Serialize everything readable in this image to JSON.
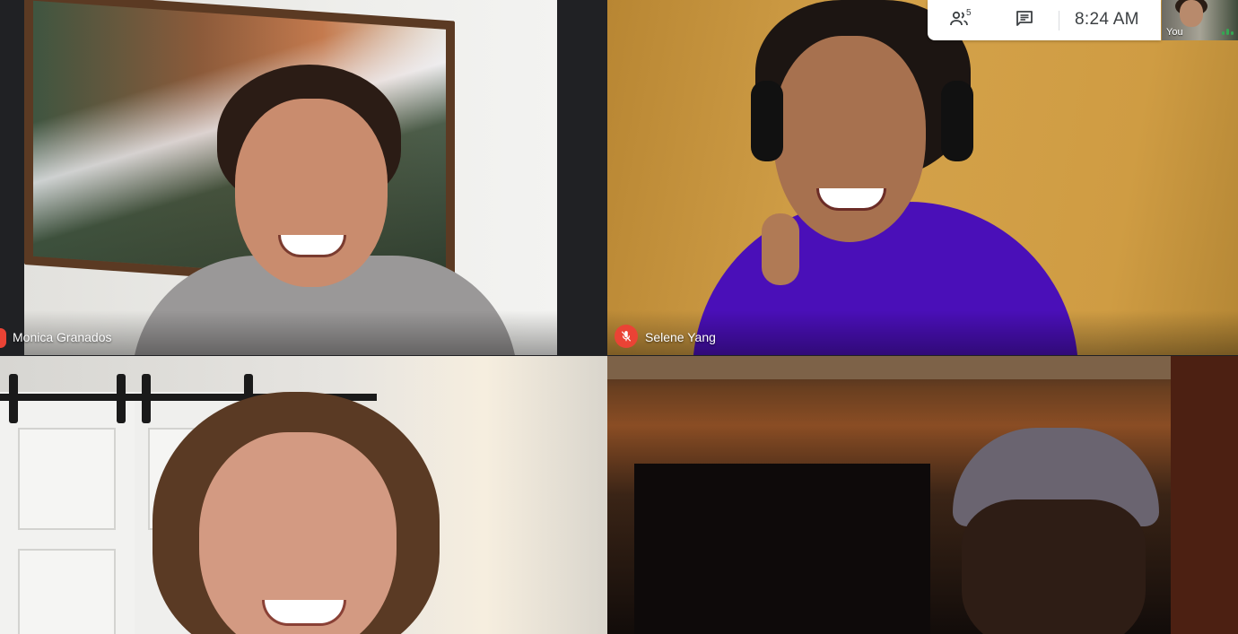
{
  "participants": [
    {
      "name": "Monica Granados",
      "muted": true
    },
    {
      "name": "Selene Yang",
      "muted": true
    },
    {
      "name": "",
      "muted": false
    },
    {
      "name": "",
      "muted": false
    }
  ],
  "top_panel": {
    "people_count": "5",
    "time": "8:24  AM",
    "people_icon": "people-icon",
    "chat_icon": "chat-icon"
  },
  "self_view": {
    "label": "You"
  },
  "colors": {
    "mute_red": "#ea4335",
    "audio_green": "#34a853",
    "background": "#202124"
  }
}
